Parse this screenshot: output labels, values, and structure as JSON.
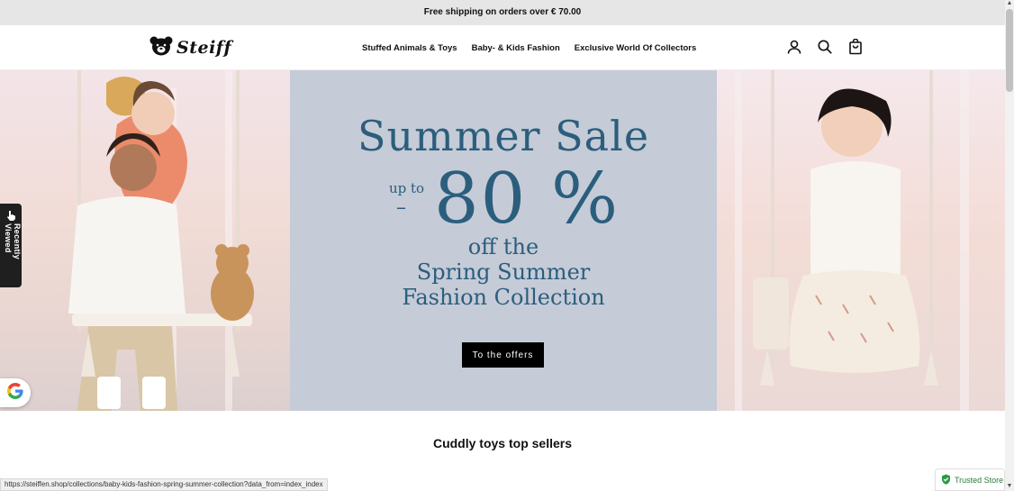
{
  "announcement": "Free shipping on orders over € 70.00",
  "brand": {
    "name": "Steiff",
    "logo_icon": "teddy-bear-head-icon"
  },
  "nav": {
    "items": [
      {
        "label": "Stuffed Animals & Toys"
      },
      {
        "label": "Baby- & Kids Fashion"
      },
      {
        "label": "Exclusive World Of Collectors"
      }
    ]
  },
  "header_icons": [
    "account-icon",
    "search-icon",
    "cart-icon"
  ],
  "hero": {
    "title": "Summer Sale",
    "up_to": "up to",
    "dash": "–",
    "discount": "80 %",
    "line1": "off the",
    "line2": "Spring Summer",
    "line3": "Fashion Collection",
    "cta_label": "To the offers",
    "accent_color": "#2b5e7d",
    "panel_color": "#c5cbd7"
  },
  "recently_viewed": "Recently Viewed",
  "section_title": "Cuddly toys top sellers",
  "status_url": "https://steiffen.shop/collections/baby-kids-fashion-spring-summer-collection?data_from=index_index",
  "trusted_store": "Trusted Store"
}
